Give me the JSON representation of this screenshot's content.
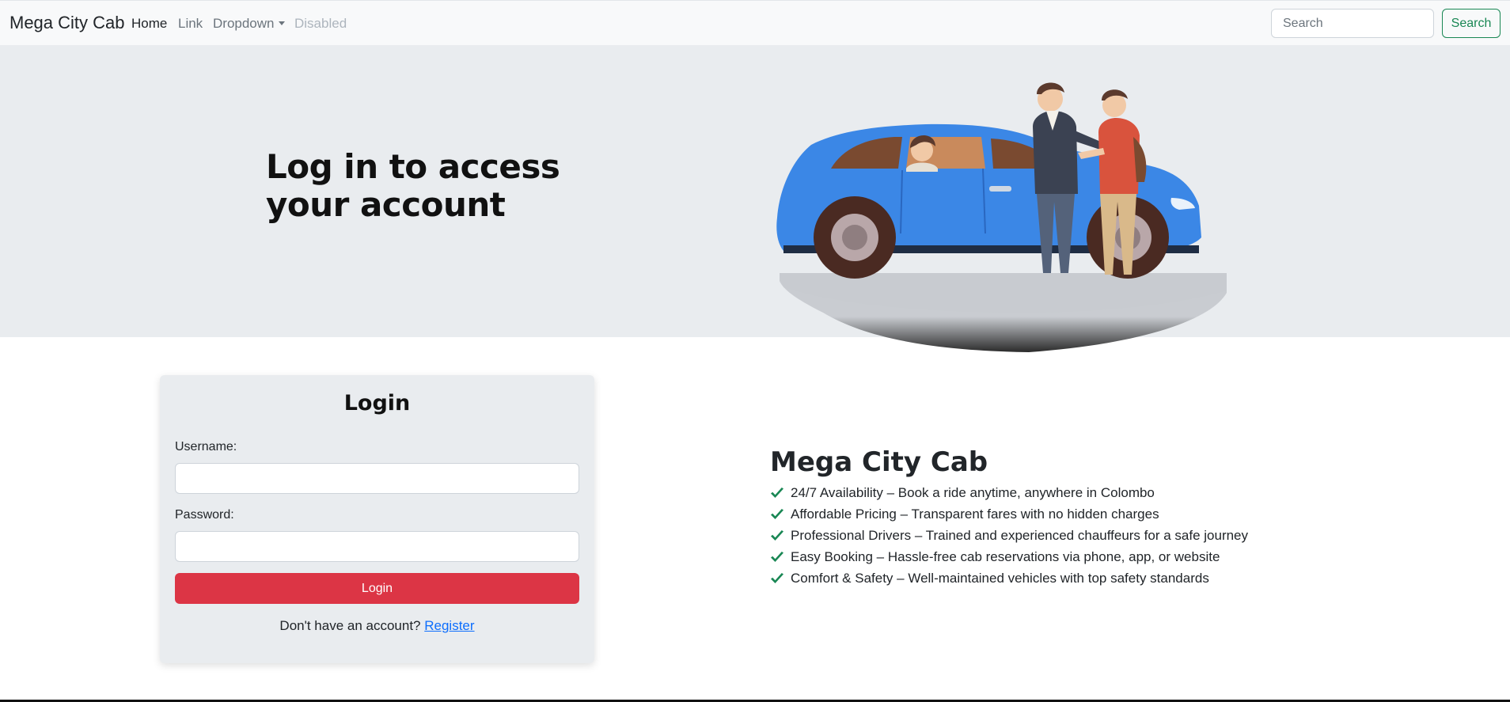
{
  "navbar": {
    "brand": "Mega City Cab",
    "links": [
      {
        "label": "Home",
        "state": "active"
      },
      {
        "label": "Link",
        "state": "normal"
      },
      {
        "label": "Dropdown",
        "state": "dropdown"
      },
      {
        "label": "Disabled",
        "state": "disabled"
      }
    ],
    "search": {
      "placeholder": "Search",
      "value": "",
      "button_label": "Search"
    }
  },
  "hero": {
    "title": "Log in to access your account"
  },
  "login": {
    "title": "Login",
    "username_label": "Username:",
    "username_value": "",
    "password_label": "Password:",
    "password_value": "",
    "button_label": "Login",
    "register_prompt": "Don't have an account?",
    "register_link": "Register"
  },
  "features": {
    "title": "Mega City Cab",
    "items": [
      "24/7 Availability – Book a ride anytime, anywhere in Colombo",
      "Affordable Pricing – Transparent fares with no hidden charges",
      "Professional Drivers – Trained and experienced chauffeurs for a safe journey",
      "Easy Booking – Hassle-free cab reservations via phone, app, or website",
      "Comfort & Safety – Well-maintained vehicles with top safety standards"
    ],
    "item_icon": "check-icon"
  },
  "colors": {
    "navbar_bg": "#f8f9fa",
    "hero_bg": "#e9ecef",
    "search_button": "#198754",
    "login_button": "#dc3545",
    "link": "#0d6efd",
    "check": "#198754",
    "car": "#3b87e6"
  }
}
